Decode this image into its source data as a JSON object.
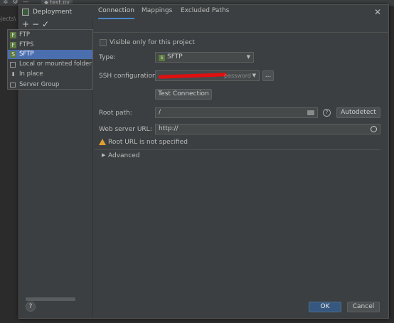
{
  "ide": {
    "file_tab": "test.py",
    "path_fragment": "ojects\\"
  },
  "dialog": {
    "title": "Deployment"
  },
  "toolbar": {
    "add": "+",
    "remove": "−",
    "apply": "✓"
  },
  "server_type_menu": {
    "items": [
      "FTP",
      "FTPS",
      "SFTP",
      "Local or mounted folder",
      "In place",
      "Server Group"
    ],
    "selected": "SFTP"
  },
  "tabs": [
    "Connection",
    "Mappings",
    "Excluded Paths"
  ],
  "connection": {
    "visible_only_label": "Visible only for this project",
    "type_label": "Type:",
    "type_value": "SFTP",
    "ssh_label": "SSH configuration:",
    "ssh_value_suffix": "password",
    "ssh_more": "...",
    "test_connection": "Test Connection",
    "root_path_label": "Root path:",
    "root_path_value": "/",
    "autodetect": "Autodetect",
    "web_url_label": "Web server URL:",
    "web_url_value": "http://",
    "warning": "Root URL is not specified",
    "advanced": "Advanced"
  },
  "footer": {
    "help": "?",
    "ok": "OK",
    "cancel": "Cancel"
  }
}
